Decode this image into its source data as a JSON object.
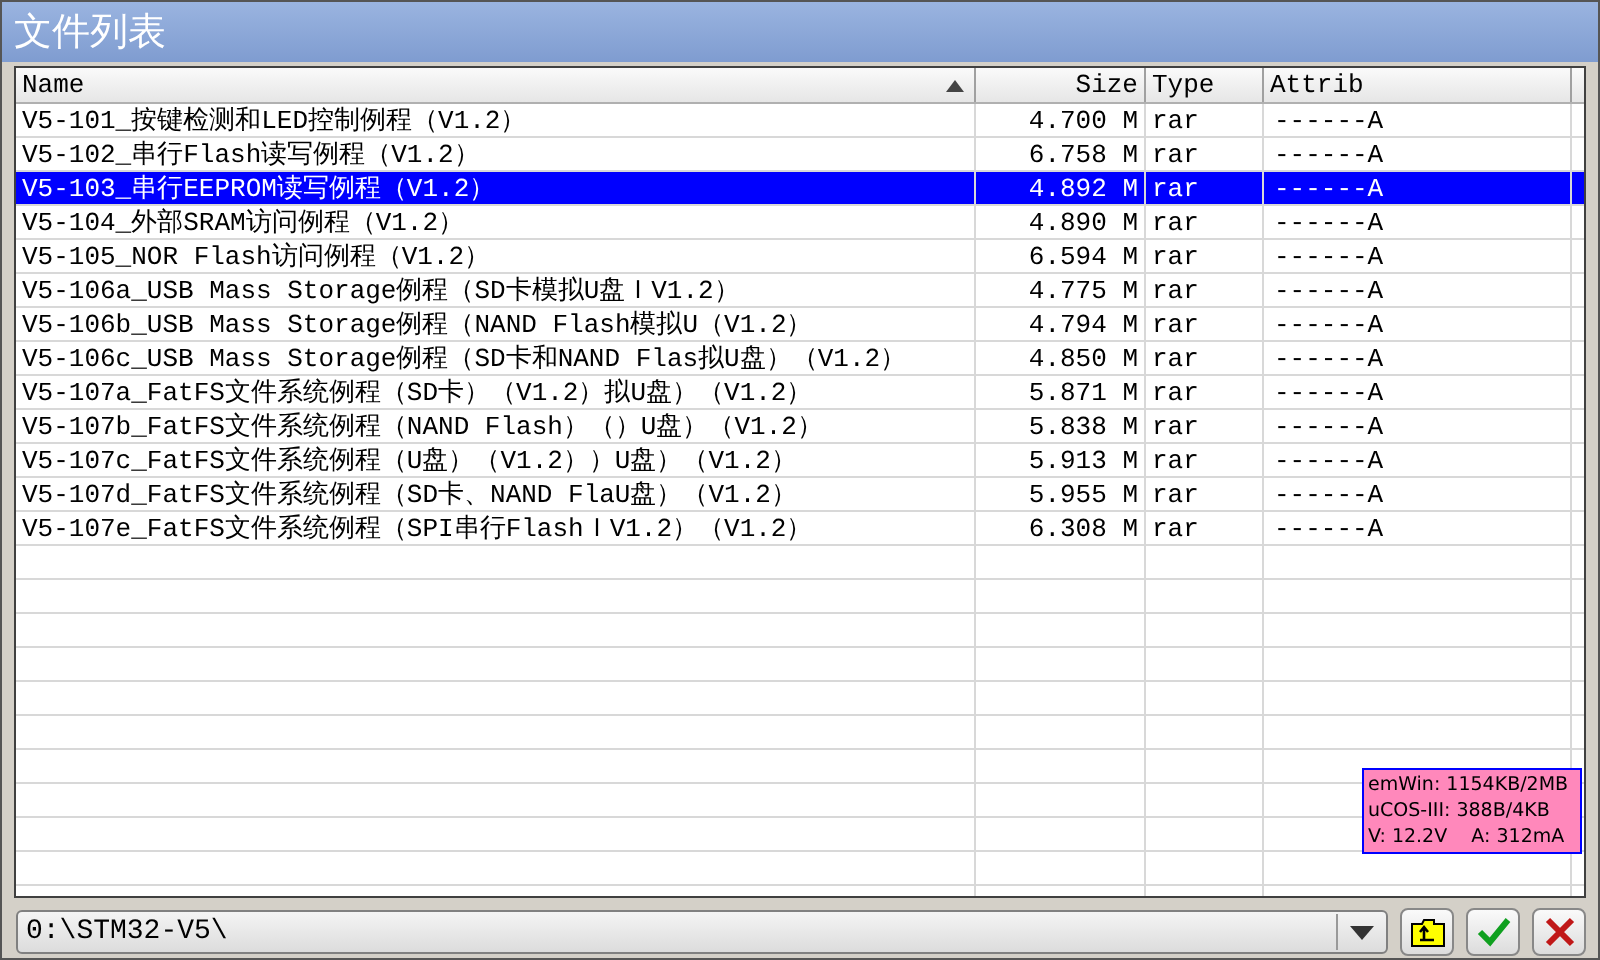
{
  "window": {
    "title": "文件列表"
  },
  "table": {
    "columns": [
      {
        "label": "Name",
        "sorted": true
      },
      {
        "label": "Size",
        "sorted": false
      },
      {
        "label": "Type",
        "sorted": false
      },
      {
        "label": "Attrib",
        "sorted": false
      }
    ],
    "rows": [
      {
        "name": "V5-101_按键检测和LED控制例程（V1.2）",
        "size": "4.700 M",
        "type": "rar",
        "attrib": "------A",
        "selected": false
      },
      {
        "name": "V5-102_串行Flash读写例程（V1.2）",
        "size": "6.758 M",
        "type": "rar",
        "attrib": "------A",
        "selected": false
      },
      {
        "name": "V5-103_串行EEPROM读写例程（V1.2）",
        "size": "4.892 M",
        "type": "rar",
        "attrib": "------A",
        "selected": true
      },
      {
        "name": "V5-104_外部SRAM访问例程（V1.2）",
        "size": "4.890 M",
        "type": "rar",
        "attrib": "------A",
        "selected": false
      },
      {
        "name": "V5-105_NOR Flash访问例程（V1.2）",
        "size": "6.594 M",
        "type": "rar",
        "attrib": "------A",
        "selected": false
      },
      {
        "name": "V5-106a_USB Mass Storage例程（SD卡模拟U盘ＩV1.2）",
        "size": "4.775 M",
        "type": "rar",
        "attrib": "------A",
        "selected": false
      },
      {
        "name": "V5-106b_USB Mass Storage例程（NAND Flash模拟U（V1.2）",
        "size": "4.794 M",
        "type": "rar",
        "attrib": "------A",
        "selected": false
      },
      {
        "name": "V5-106c_USB Mass Storage例程（SD卡和NAND Flas拟U盘）（V1.2）",
        "size": "4.850 M",
        "type": "rar",
        "attrib": "------A",
        "selected": false
      },
      {
        "name": "V5-107a_FatFS文件系统例程（SD卡）（V1.2）拟U盘）（V1.2）",
        "size": "5.871 M",
        "type": "rar",
        "attrib": "------A",
        "selected": false
      },
      {
        "name": "V5-107b_FatFS文件系统例程（NAND Flash）（）U盘）（V1.2）",
        "size": "5.838 M",
        "type": "rar",
        "attrib": "------A",
        "selected": false
      },
      {
        "name": "V5-107c_FatFS文件系统例程（U盘）（V1.2））U盘）（V1.2）",
        "size": "5.913 M",
        "type": "rar",
        "attrib": "------A",
        "selected": false
      },
      {
        "name": "V5-107d_FatFS文件系统例程（SD卡、NAND FlaU盘）（V1.2）",
        "size": "5.955 M",
        "type": "rar",
        "attrib": "------A",
        "selected": false
      },
      {
        "name": "V5-107e_FatFS文件系统例程（SPI串行FlashＩV1.2）（V1.2）",
        "size": "6.308 M",
        "type": "rar",
        "attrib": "------A",
        "selected": false
      }
    ]
  },
  "status_overlay": {
    "lines": [
      "emWin: 1154KB/2MB",
      "uCOS-III: 388B/4KB",
      "V: 12.2V    A: 312mA"
    ]
  },
  "path_field": {
    "value": "0:\\STM32-V5\\"
  }
}
